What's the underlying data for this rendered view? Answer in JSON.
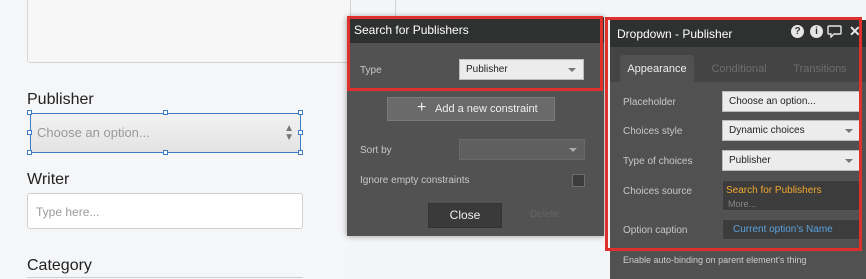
{
  "canvas": {
    "fields": [
      {
        "label": "Publisher",
        "placeholder": "Choose an option..."
      },
      {
        "label": "Writer",
        "placeholder": "Type here..."
      },
      {
        "label": "Category"
      }
    ]
  },
  "search_panel": {
    "title": "Search for Publishers",
    "type_label": "Type",
    "type_value": "Publisher",
    "add_constraint": "Add a new constraint",
    "sort_by_label": "Sort by",
    "sort_by_value": "",
    "ignore_empty_label": "Ignore empty constraints",
    "ignore_empty_checked": false,
    "close_label": "Close",
    "delete_label": "Delete"
  },
  "prop_panel": {
    "title": "Dropdown - Publisher",
    "icons": [
      "help-icon",
      "info-icon",
      "comment-icon",
      "close-icon"
    ],
    "tabs": [
      {
        "label": "Appearance",
        "active": true
      },
      {
        "label": "Conditional",
        "active": false
      },
      {
        "label": "Transitions",
        "active": false
      }
    ],
    "placeholder_label": "Placeholder",
    "placeholder_value": "Choose an option...",
    "choices_style_label": "Choices style",
    "choices_style_value": "Dynamic choices",
    "type_of_choices_label": "Type of choices",
    "type_of_choices_value": "Publisher",
    "choices_source_label": "Choices source",
    "choices_source_value": "Search for Publishers",
    "choices_source_more": "More...",
    "option_caption_label": "Option caption",
    "option_caption_value": "Current option's Name",
    "auto_binding_label": "Enable auto-binding on parent element's thing"
  },
  "colors": {
    "highlight": "#e0302c",
    "panel_bg": "#525252",
    "title_bar": "#2f3030",
    "selection_blue": "#3d7bc4",
    "source_orange": "#f0a830",
    "caption_blue": "#5aa3e0"
  }
}
